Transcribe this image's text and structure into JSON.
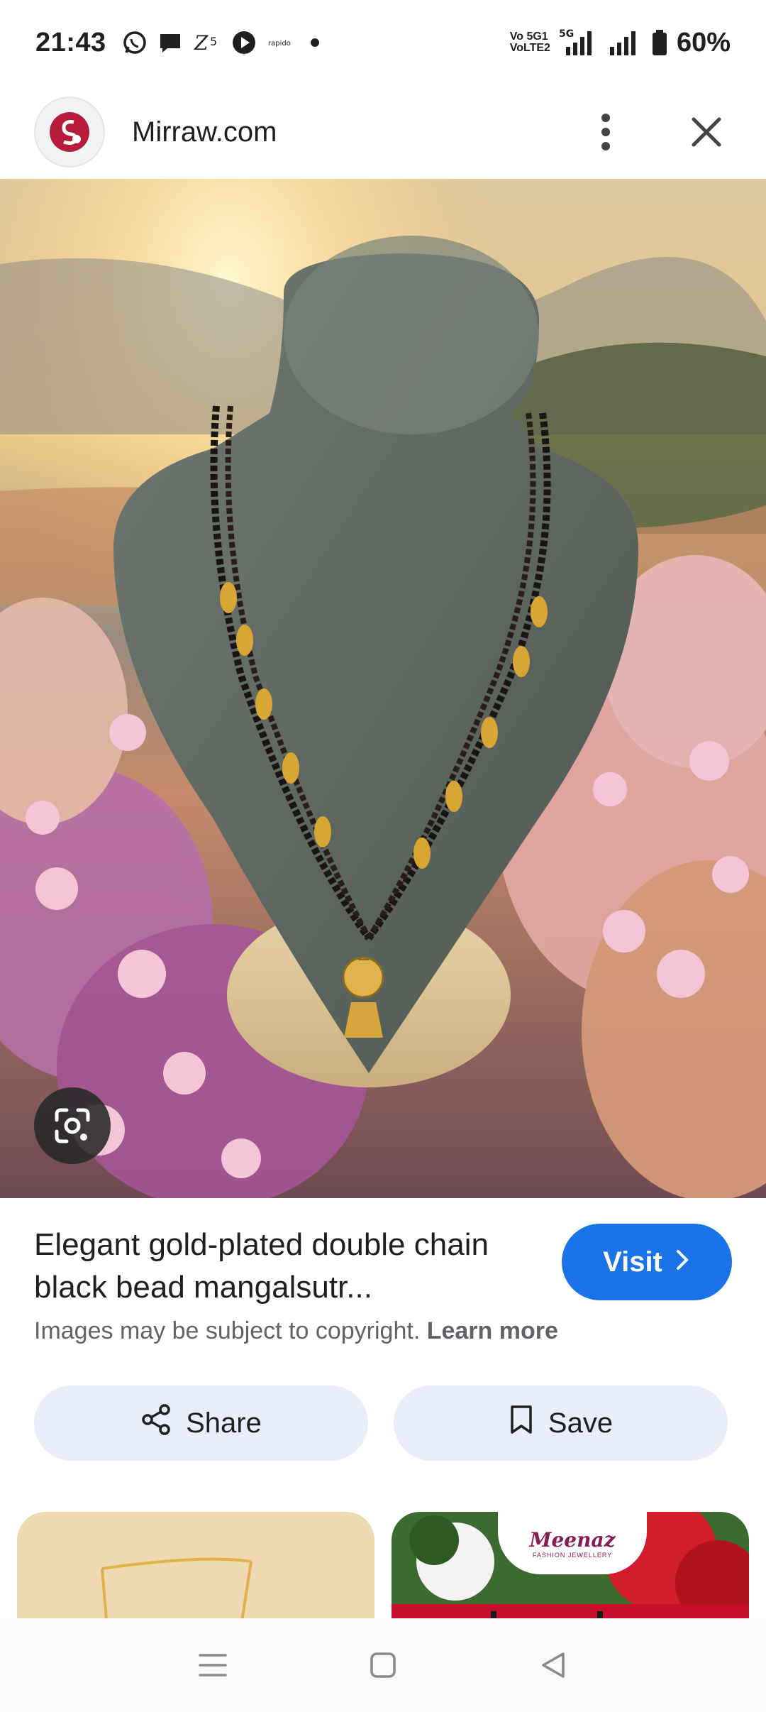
{
  "status_bar": {
    "time": "21:43",
    "network_label_top": "Vo 5G1",
    "network_label_bottom": "VoLTE2",
    "network_type": "5G",
    "battery": "60%",
    "icons": [
      "whatsapp-icon",
      "chat-icon",
      "z5-icon",
      "play-icon",
      "rapido-icon",
      "dot-icon",
      "signal-icon",
      "signal-icon",
      "battery-icon"
    ],
    "rapido_label": "rapido"
  },
  "header": {
    "site_name": "Mirraw.com",
    "favicon_icon": "mirraw-logo-icon",
    "more_icon": "more-vertical-icon",
    "close_icon": "close-icon"
  },
  "hero": {
    "image_description_icon": "necklace-photo",
    "lens_icon": "google-lens-icon"
  },
  "result": {
    "title": "Elegant gold-plated double chain black bead mangalsutr...",
    "visit_label": "Visit",
    "copyright_text": "Images may be subject to copyright.",
    "learn_more": "Learn more",
    "share_label": "Share",
    "save_label": "Save"
  },
  "related": {
    "thumb2_brand": "Meenaz",
    "thumb2_sub": "FASHION JEWELLERY"
  },
  "colors": {
    "visit_button": "#1a73e8",
    "action_buttons": "#e8eefb",
    "text_primary": "#1f1f1f",
    "text_secondary": "#5f6368"
  }
}
